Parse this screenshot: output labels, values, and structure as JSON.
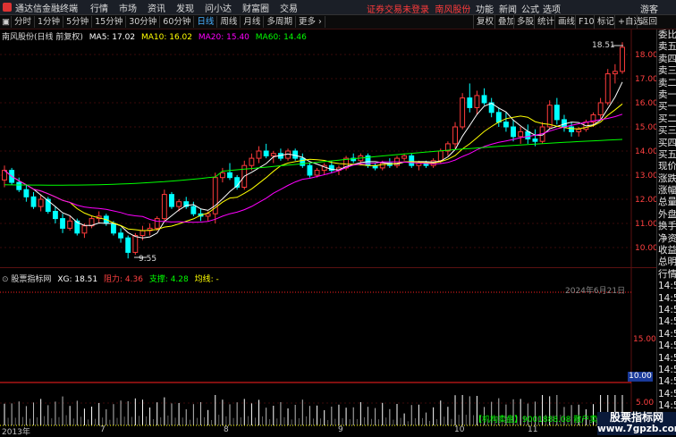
{
  "titlebar": {
    "app_name": "通达信金融终端",
    "menus": [
      "行情",
      "市场",
      "资讯",
      "发现",
      "问小达",
      "财富圈",
      "交易"
    ],
    "notice": "证券交易未登录",
    "stock_link": "南风股份",
    "right_items": [
      "功能",
      "新闻",
      "公式",
      "选项"
    ],
    "guest": "游客"
  },
  "toolbar": {
    "periods": [
      "分时",
      "1分钟",
      "5分钟",
      "15分钟",
      "30分钟",
      "60分钟",
      "日线",
      "周线",
      "月线",
      "多周期",
      "更多"
    ],
    "active": "日线",
    "right": [
      "复权",
      "叠加",
      "多股",
      "统计",
      "画线",
      "F10",
      "标记",
      "+自选",
      "返回"
    ]
  },
  "legend": {
    "stock": "南风股份(日线 前复权)",
    "ma5": "MA5: 17.02",
    "ma10": "MA10: 16.02",
    "ma20": "MA20: 15.40",
    "ma60": "MA60: 14.46"
  },
  "price_axis": [
    "18.00",
    "17.00",
    "16.00",
    "15.00",
    "14.00",
    "13.00",
    "12.00",
    "11.00",
    "10.00"
  ],
  "high_label": "18.51",
  "low_label": "9.55",
  "indicator": {
    "name": "股票指标网",
    "xg": "XG: 18.51",
    "zuli": "阻力: 4.36",
    "zhicheng": "支撑: 4.28",
    "junxian": "均线: -"
  },
  "indicator_axis": [
    "15.00",
    "10.00",
    "5.00"
  ],
  "indicator_box": "10.00",
  "date_label": "2024年6月21日",
  "xaxis": [
    "2013年",
    "7",
    "8",
    "9",
    "10",
    "11"
  ],
  "bottom_info": "【机构卖盘】9001888.08  散户卖盘",
  "side_panel": [
    "委比",
    "卖五",
    "卖四",
    "卖三",
    "卖二",
    "卖一",
    "买一",
    "买二",
    "买三",
    "买四",
    "买五",
    "现价",
    "涨跌",
    "涨幅",
    "总量",
    "外盘",
    "换手",
    "净资",
    "收益",
    "总明",
    "行情",
    "14:5",
    "14:5",
    "14:5",
    "14:5",
    "14:5",
    "14:5",
    "14:5",
    "14:5",
    "14:5",
    "14:5",
    "14:5"
  ],
  "watermark": {
    "title": "股票指标网",
    "url": "www.7gpzb.com"
  },
  "colors": {
    "up": "#ff3b3b",
    "down": "#00ffff",
    "ma5": "#ffffff",
    "ma10": "#ffff00",
    "ma20": "#ff00ff",
    "ma60": "#00ff00"
  },
  "chart_data": {
    "type": "candlestick",
    "ohlc": [
      [
        12.8,
        13.4,
        12.5,
        13.2
      ],
      [
        13.2,
        13.3,
        12.6,
        12.7
      ],
      [
        12.7,
        12.9,
        12.3,
        12.4
      ],
      [
        12.4,
        12.6,
        11.9,
        12.1
      ],
      [
        12.1,
        12.3,
        11.6,
        11.7
      ],
      [
        11.7,
        12.2,
        11.5,
        12.0
      ],
      [
        12.0,
        12.1,
        11.4,
        11.5
      ],
      [
        11.5,
        11.7,
        11.0,
        11.2
      ],
      [
        11.2,
        11.4,
        10.6,
        10.8
      ],
      [
        10.8,
        11.3,
        10.7,
        11.1
      ],
      [
        11.1,
        11.2,
        10.5,
        10.6
      ],
      [
        10.6,
        11.0,
        10.4,
        10.9
      ],
      [
        10.9,
        11.3,
        10.8,
        11.2
      ],
      [
        11.2,
        11.5,
        11.0,
        11.3
      ],
      [
        11.3,
        11.4,
        10.9,
        11.0
      ],
      [
        11.0,
        11.1,
        10.5,
        10.6
      ],
      [
        10.6,
        10.8,
        10.2,
        10.4
      ],
      [
        10.4,
        10.5,
        9.55,
        9.8
      ],
      [
        9.8,
        10.6,
        9.7,
        10.5
      ],
      [
        10.5,
        10.9,
        10.3,
        10.7
      ],
      [
        10.7,
        11.0,
        10.5,
        10.8
      ],
      [
        10.8,
        11.3,
        10.7,
        11.2
      ],
      [
        11.2,
        12.4,
        11.1,
        12.2
      ],
      [
        12.2,
        12.3,
        11.6,
        11.7
      ],
      [
        11.7,
        12.0,
        11.5,
        11.9
      ],
      [
        11.9,
        12.1,
        11.6,
        11.7
      ],
      [
        11.7,
        11.9,
        11.3,
        11.4
      ],
      [
        11.4,
        11.6,
        11.1,
        11.3
      ],
      [
        11.3,
        11.5,
        11.1,
        11.4
      ],
      [
        11.4,
        13.1,
        11.0,
        12.9
      ],
      [
        12.9,
        13.3,
        12.7,
        13.1
      ],
      [
        13.1,
        13.5,
        12.8,
        12.9
      ],
      [
        12.9,
        13.0,
        12.4,
        12.5
      ],
      [
        12.5,
        13.6,
        12.4,
        13.4
      ],
      [
        13.4,
        13.9,
        13.2,
        13.7
      ],
      [
        13.7,
        14.2,
        13.5,
        14.0
      ],
      [
        14.0,
        14.3,
        13.7,
        13.8
      ],
      [
        13.8,
        14.0,
        13.5,
        13.9
      ],
      [
        13.9,
        14.1,
        13.6,
        13.7
      ],
      [
        13.7,
        14.1,
        13.6,
        14.0
      ],
      [
        14.0,
        14.1,
        13.6,
        13.7
      ],
      [
        13.7,
        13.9,
        13.3,
        13.4
      ],
      [
        13.4,
        13.5,
        12.9,
        13.0
      ],
      [
        13.0,
        13.3,
        12.9,
        13.2
      ],
      [
        13.2,
        13.5,
        13.0,
        13.4
      ],
      [
        13.4,
        13.6,
        13.1,
        13.2
      ],
      [
        13.2,
        13.4,
        13.0,
        13.3
      ],
      [
        13.3,
        13.8,
        13.2,
        13.7
      ],
      [
        13.7,
        13.9,
        13.5,
        13.6
      ],
      [
        13.6,
        13.9,
        13.4,
        13.8
      ],
      [
        13.8,
        13.9,
        13.3,
        13.4
      ],
      [
        13.4,
        13.5,
        13.2,
        13.3
      ],
      [
        13.3,
        13.6,
        13.2,
        13.5
      ],
      [
        13.5,
        13.7,
        13.3,
        13.4
      ],
      [
        13.4,
        13.8,
        13.3,
        13.7
      ],
      [
        13.7,
        13.9,
        13.6,
        13.8
      ],
      [
        13.8,
        13.9,
        13.3,
        13.4
      ],
      [
        13.4,
        13.6,
        13.2,
        13.5
      ],
      [
        13.5,
        13.6,
        13.3,
        13.4
      ],
      [
        13.4,
        13.7,
        13.3,
        13.6
      ],
      [
        13.6,
        14.1,
        13.5,
        14.0
      ],
      [
        14.0,
        14.4,
        13.8,
        14.3
      ],
      [
        14.3,
        15.2,
        14.1,
        15.0
      ],
      [
        15.0,
        16.4,
        14.9,
        16.2
      ],
      [
        16.2,
        16.8,
        15.6,
        15.8
      ],
      [
        15.8,
        16.5,
        15.5,
        16.3
      ],
      [
        16.3,
        16.6,
        15.9,
        16.0
      ],
      [
        16.0,
        16.2,
        15.4,
        15.6
      ],
      [
        15.6,
        15.8,
        15.0,
        15.2
      ],
      [
        15.2,
        15.6,
        14.8,
        15.0
      ],
      [
        15.0,
        15.3,
        14.4,
        14.6
      ],
      [
        14.6,
        15.0,
        14.3,
        14.8
      ],
      [
        14.8,
        15.1,
        14.3,
        14.5
      ],
      [
        14.5,
        14.9,
        14.2,
        14.4
      ],
      [
        14.4,
        15.2,
        14.3,
        15.0
      ],
      [
        15.0,
        16.1,
        14.9,
        15.9
      ],
      [
        15.9,
        16.2,
        15.1,
        15.3
      ],
      [
        15.3,
        15.5,
        14.8,
        15.0
      ],
      [
        15.0,
        15.2,
        14.6,
        14.8
      ],
      [
        14.8,
        15.0,
        14.6,
        14.9
      ],
      [
        14.9,
        15.3,
        14.8,
        15.2
      ],
      [
        15.2,
        15.6,
        15.0,
        15.5
      ],
      [
        15.5,
        16.2,
        15.3,
        16.0
      ],
      [
        16.0,
        17.4,
        15.9,
        17.2
      ],
      [
        17.2,
        17.6,
        16.8,
        17.3
      ],
      [
        17.3,
        18.51,
        17.2,
        18.3
      ]
    ]
  }
}
